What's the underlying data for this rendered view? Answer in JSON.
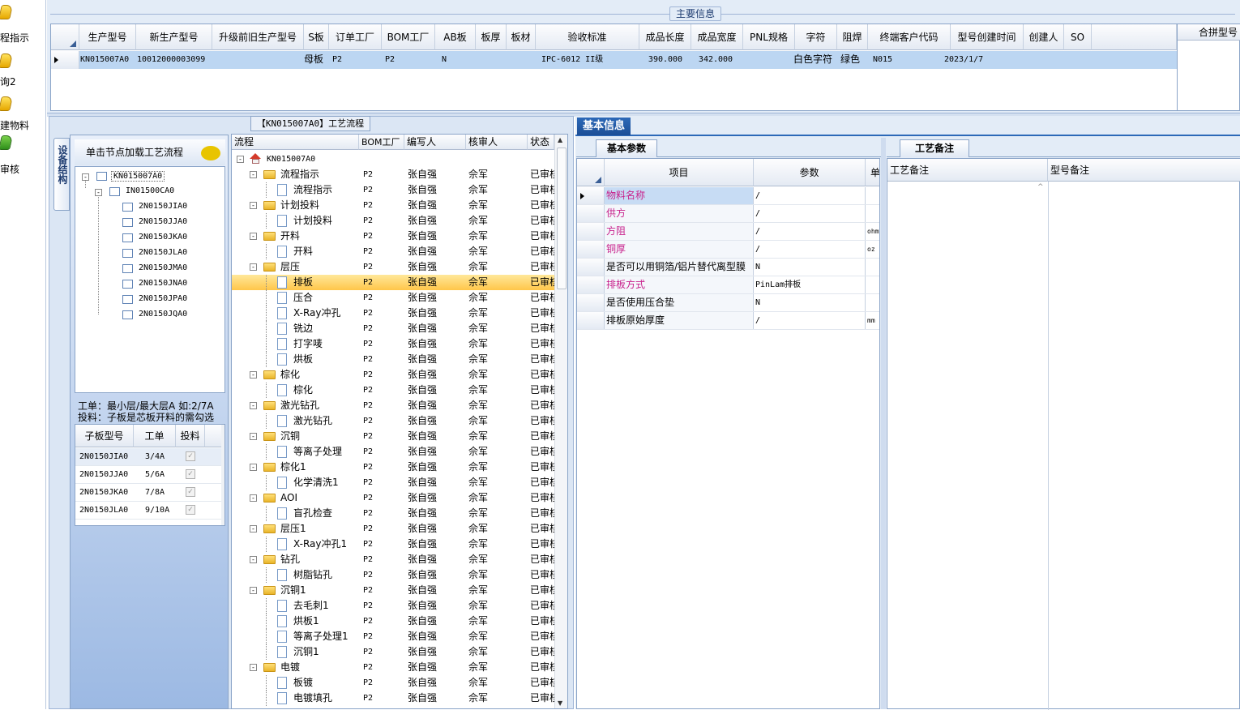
{
  "sidebar": {
    "items": [
      {
        "label": "程指示"
      },
      {
        "label": "询2"
      },
      {
        "label": "建物料"
      },
      {
        "label": "审核"
      }
    ]
  },
  "main_info": {
    "title": "主要信息",
    "columns": [
      "生产型号",
      "新生产型号",
      "升级前旧生产型号",
      "S板",
      "订单工厂",
      "BOM工厂",
      "AB板",
      "板厚",
      "板材",
      "验收标准",
      "成品长度",
      "成品宽度",
      "PNL规格",
      "字符",
      "阻焊",
      "终端客户代码",
      "型号创建时间",
      "创建人",
      "SO"
    ],
    "row": {
      "生产型号": "KN015007A0",
      "新生产型号": "10012000003099",
      "S板": "母板",
      "订单工厂": "P2",
      "BOM工厂": "P2",
      "AB板": "N",
      "验收标准": "IPC-6012 II级",
      "成品长度": "390.000",
      "成品宽度": "342.000",
      "字符": "白色字符",
      "阻焊": "绿色",
      "终端客户代码": "N015",
      "型号创建时间": "2023/1/7"
    },
    "right_header": "合拼型号"
  },
  "structure": {
    "vtab_label": "设备结构",
    "hint": "单击节点加载工艺流程",
    "root": "KN015007A0",
    "child": "IN01500CA0",
    "leaves": [
      "2N0150JIA0",
      "2N0150JJA0",
      "2N0150JKA0",
      "2N0150JLA0",
      "2N0150JMA0",
      "2N0150JNA0",
      "2N0150JPA0",
      "2N0150JQA0"
    ],
    "info1": "工单：最小层/最大层A 如:2/7A",
    "info2": "投料：子板是芯板开料的需勾选",
    "sub_columns": [
      "子板型号",
      "工单",
      "投料"
    ],
    "sub_rows": [
      {
        "model": "2N0150JIA0",
        "order": "3/4A"
      },
      {
        "model": "2N0150JJA0",
        "order": "5/6A"
      },
      {
        "model": "2N0150JKA0",
        "order": "7/8A"
      },
      {
        "model": "2N0150JLA0",
        "order": "9/10A"
      }
    ]
  },
  "flow": {
    "title": "【KN015007A0】工艺流程",
    "columns": [
      "流程",
      "BOM工厂",
      "编写人",
      "核审人",
      "状态"
    ],
    "root": "KN015007A0",
    "rows": [
      {
        "name": "流程指示",
        "level": 1
      },
      {
        "name": "流程指示",
        "level": 2
      },
      {
        "name": "计划投料",
        "level": 1
      },
      {
        "name": "计划投料",
        "level": 2
      },
      {
        "name": "开料",
        "level": 1
      },
      {
        "name": "开料",
        "level": 2
      },
      {
        "name": "层压",
        "level": 1
      },
      {
        "name": "排板",
        "level": 2,
        "selected": true
      },
      {
        "name": "压合",
        "level": 2
      },
      {
        "name": "X-Ray冲孔",
        "level": 2
      },
      {
        "name": "铣边",
        "level": 2
      },
      {
        "name": "打字唛",
        "level": 2
      },
      {
        "name": "烘板",
        "level": 2
      },
      {
        "name": "棕化",
        "level": 1
      },
      {
        "name": "棕化",
        "level": 2
      },
      {
        "name": "激光钻孔",
        "level": 1
      },
      {
        "name": "激光钻孔",
        "level": 2
      },
      {
        "name": "沉铜",
        "level": 1
      },
      {
        "name": "等离子处理",
        "level": 2
      },
      {
        "name": "棕化1",
        "level": 1
      },
      {
        "name": "化学清洗1",
        "level": 2
      },
      {
        "name": "AOI",
        "level": 1
      },
      {
        "name": "盲孔检查",
        "level": 2
      },
      {
        "name": "层压1",
        "level": 1
      },
      {
        "name": "X-Ray冲孔1",
        "level": 2
      },
      {
        "name": "钻孔",
        "level": 1
      },
      {
        "name": "树脂钻孔",
        "level": 2
      },
      {
        "name": "沉铜1",
        "level": 1
      },
      {
        "name": "去毛刺1",
        "level": 2
      },
      {
        "name": "烘板1",
        "level": 2
      },
      {
        "name": "等离子处理1",
        "level": 2
      },
      {
        "name": "沉铜1",
        "level": 2
      },
      {
        "name": "电镀",
        "level": 1
      },
      {
        "name": "板镀",
        "level": 2
      },
      {
        "name": "电镀填孔",
        "level": 2
      }
    ],
    "bom": "P2",
    "writer": "张自强",
    "reviewer": "佘军",
    "status": "已审核"
  },
  "basic": {
    "tab": "基本信息",
    "param_tab": "基本参数",
    "columns": [
      "项目",
      "参数",
      "单"
    ],
    "rows": [
      {
        "item": "物料名称",
        "value": "/",
        "unit": "",
        "pink": true
      },
      {
        "item": "供方",
        "value": "/",
        "unit": "",
        "pink": true
      },
      {
        "item": "方阻",
        "value": "/",
        "unit": "ohm",
        "pink": true
      },
      {
        "item": "铜厚",
        "value": "/",
        "unit": "oz",
        "pink": true
      },
      {
        "item": "是否可以用铜箔/铝片替代离型膜",
        "value": "N",
        "unit": "",
        "pink": false
      },
      {
        "item": "排板方式",
        "value": "PinLam排板",
        "unit": "",
        "pink": true
      },
      {
        "item": "是否使用压合垫",
        "value": "N",
        "unit": "",
        "pink": false
      },
      {
        "item": "排板原始厚度",
        "value": "/",
        "unit": "mm",
        "pink": false
      }
    ]
  },
  "remarks": {
    "tab": "工艺备注",
    "columns": [
      "工艺备注",
      "型号备注"
    ]
  }
}
